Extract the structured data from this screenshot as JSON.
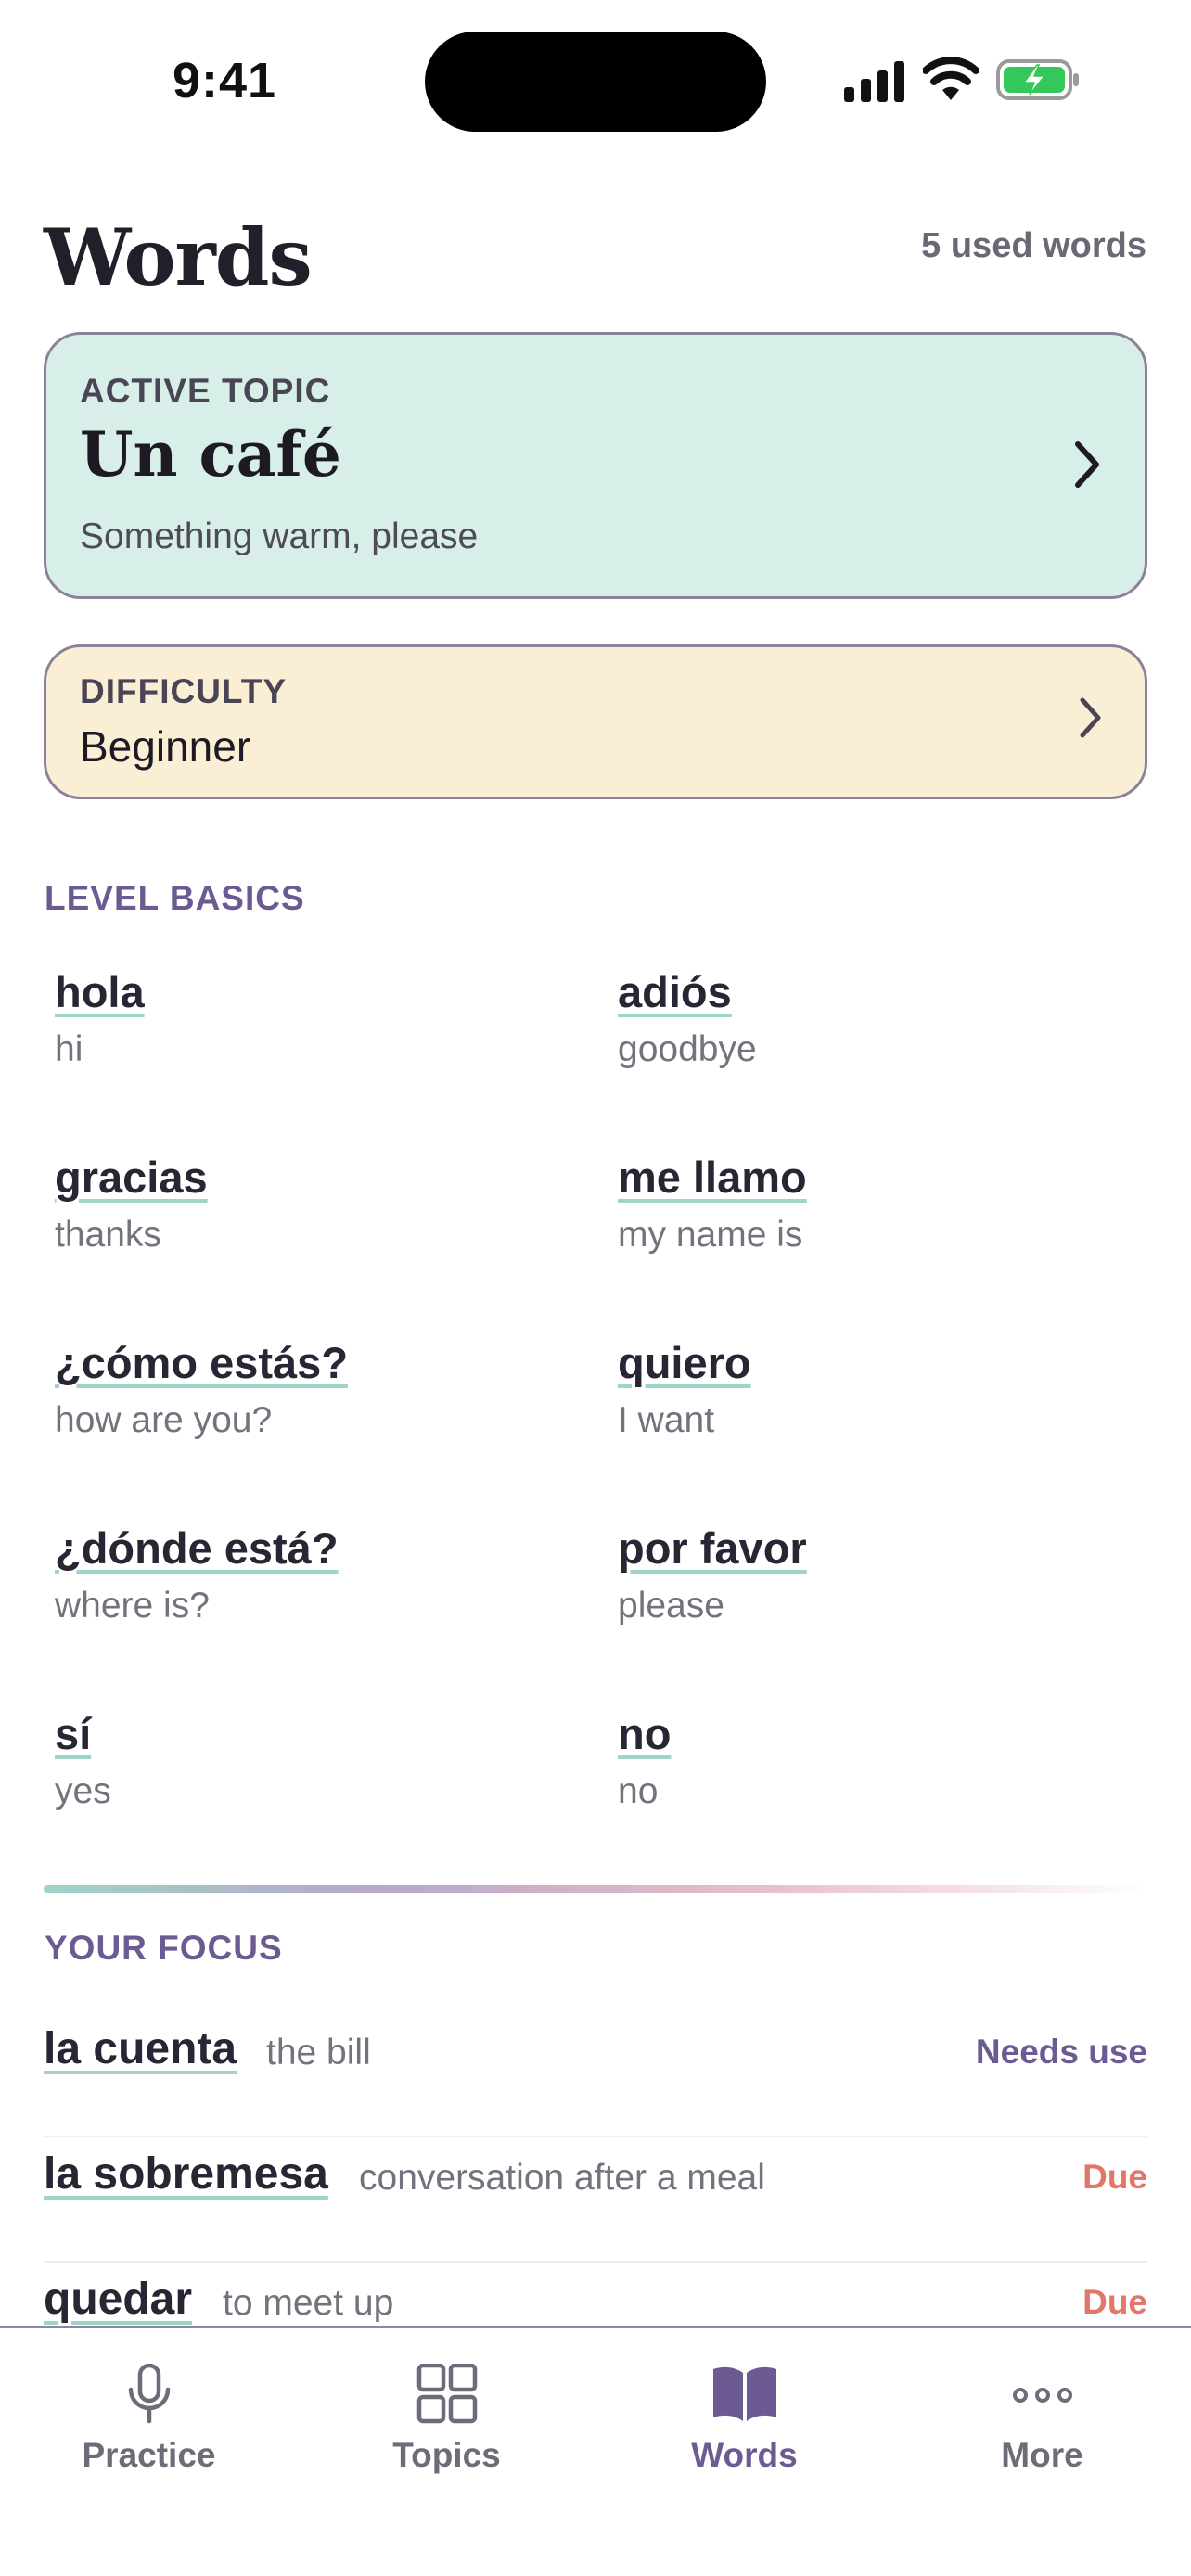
{
  "status_bar": {
    "time": "9:41"
  },
  "header": {
    "title": "Words",
    "used_count": "5 used words"
  },
  "active_topic": {
    "kicker": "ACTIVE TOPIC",
    "title": "Un café",
    "subtitle": "Something warm, please"
  },
  "difficulty": {
    "kicker": "DIFFICULTY",
    "value": "Beginner"
  },
  "level_basics": {
    "label": "LEVEL BASICS",
    "words": [
      {
        "term": "hola",
        "gloss": "hi"
      },
      {
        "term": "adiós",
        "gloss": "goodbye"
      },
      {
        "term": "gracias",
        "gloss": "thanks"
      },
      {
        "term": "me llamo",
        "gloss": "my name is"
      },
      {
        "term": "¿cómo estás?",
        "gloss": "how are you?"
      },
      {
        "term": "quiero",
        "gloss": "I want"
      },
      {
        "term": "¿dónde está?",
        "gloss": "where is?"
      },
      {
        "term": "por favor",
        "gloss": "please"
      },
      {
        "term": "sí",
        "gloss": "yes"
      },
      {
        "term": "no",
        "gloss": "no"
      }
    ]
  },
  "your_focus": {
    "label": "YOUR FOCUS",
    "items": [
      {
        "term": "la cuenta",
        "gloss": "the bill",
        "status": "Needs use"
      },
      {
        "term": "la sobremesa",
        "gloss": "conversation after a meal",
        "status": "Due"
      },
      {
        "term": "quedar",
        "gloss": "to meet up",
        "status": "Due"
      }
    ]
  },
  "tabs": [
    {
      "label": "Practice",
      "icon": "microphone-icon"
    },
    {
      "label": "Topics",
      "icon": "grid-icon"
    },
    {
      "label": "Words",
      "icon": "book-icon",
      "active": true
    },
    {
      "label": "More",
      "icon": "more-dots-icon"
    }
  ],
  "colors": {
    "accent": "#6c5a92",
    "topic_card_bg": "#d8efe9",
    "difficulty_card_bg": "#faefd5",
    "due": "#e0786a",
    "underline": "#9ed5c7"
  }
}
